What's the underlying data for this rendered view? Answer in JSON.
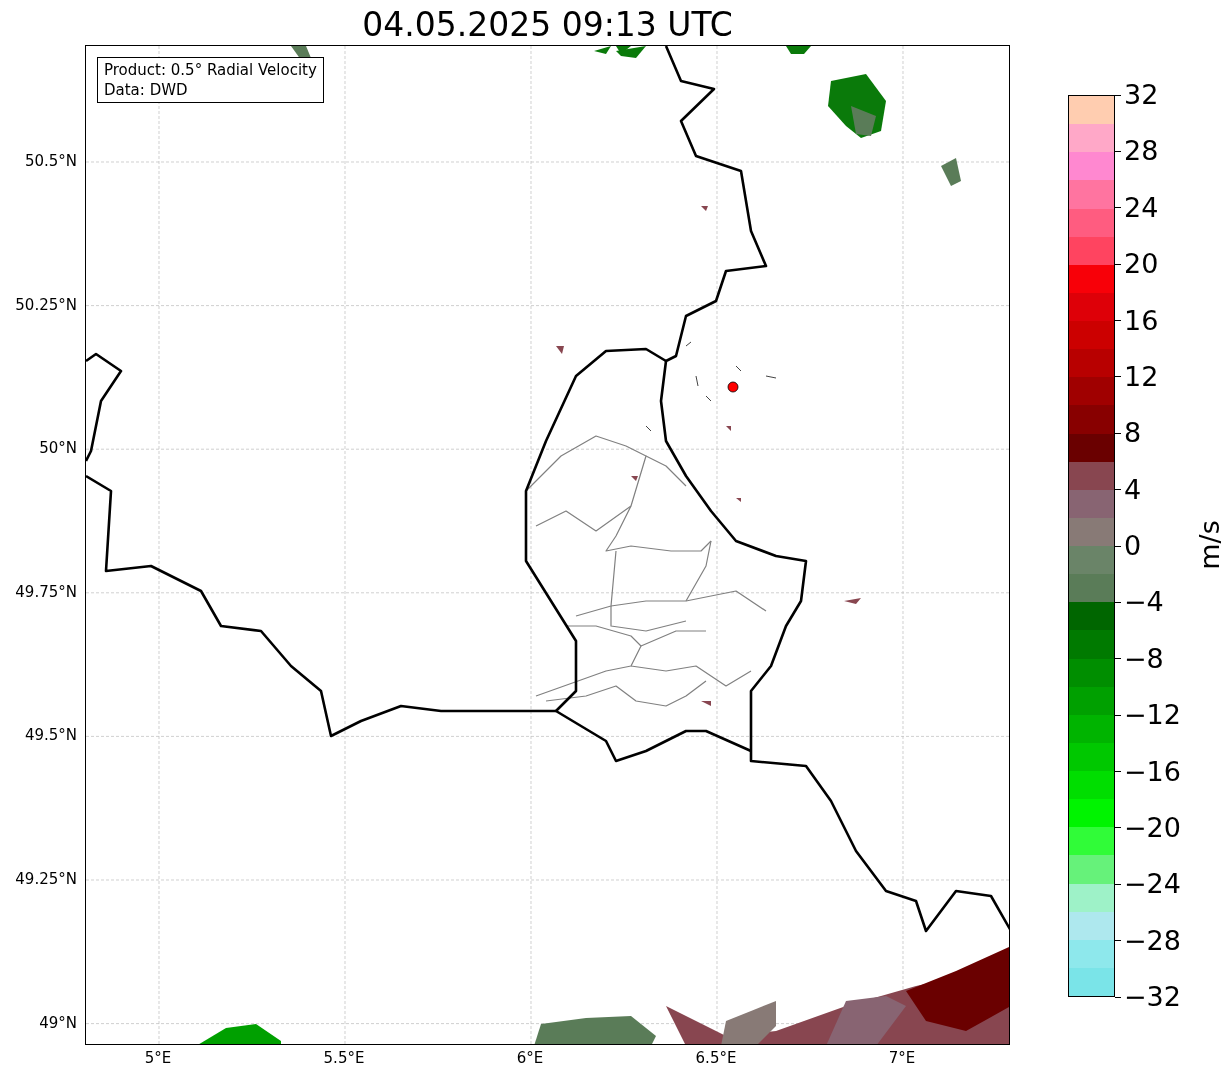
{
  "title": "04.05.2025 09:13 UTC",
  "info_box": [
    "Product: 0.5° Radial Velocity",
    "Data: DWD"
  ],
  "map": {
    "yticks": [
      "50.5°N",
      "50.25°N",
      "50°N",
      "49.75°N",
      "49.5°N",
      "49.25°N",
      "49°N"
    ],
    "xticks": [
      "5°E",
      "5.5°E",
      "6°E",
      "6.5°E",
      "7°E"
    ]
  },
  "colorbar": {
    "label": "m/s",
    "ticks": [
      "32",
      "28",
      "24",
      "20",
      "16",
      "12",
      "8",
      "4",
      "0",
      "−4",
      "−8",
      "−12",
      "−16",
      "−20",
      "−24",
      "−28",
      "−32"
    ],
    "segments": [
      {
        "color": "#7ae4e8"
      },
      {
        "color": "#8ee8ec"
      },
      {
        "color": "#aee8ee"
      },
      {
        "color": "#9ef2c8"
      },
      {
        "color": "#66f27a"
      },
      {
        "color": "#30fc38"
      },
      {
        "color": "#00f400"
      },
      {
        "color": "#00de00"
      },
      {
        "color": "#00c800"
      },
      {
        "color": "#00b400"
      },
      {
        "color": "#00a000"
      },
      {
        "color": "#008e00"
      },
      {
        "color": "#007a00"
      },
      {
        "color": "#006600"
      },
      {
        "color": "#5a7c58"
      },
      {
        "color": "#6a8468"
      },
      {
        "color": "#887a76"
      },
      {
        "color": "#886472"
      },
      {
        "color": "#884650"
      },
      {
        "color": "#6a0000"
      },
      {
        "color": "#880000"
      },
      {
        "color": "#a00000"
      },
      {
        "color": "#b80000"
      },
      {
        "color": "#cc0000"
      },
      {
        "color": "#de0008"
      },
      {
        "color": "#f80008"
      },
      {
        "color": "#ff4460"
      },
      {
        "color": "#ff5c80"
      },
      {
        "color": "#ff74a0"
      },
      {
        "color": "#ff88d0"
      },
      {
        "color": "#ffa8c8"
      },
      {
        "color": "#ffcdb0"
      }
    ]
  }
}
